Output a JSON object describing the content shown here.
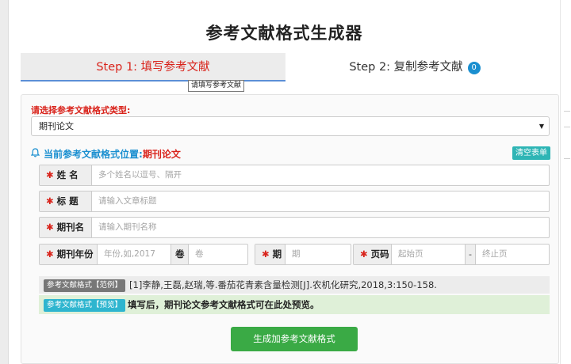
{
  "page_title": "参考文献格式生成器",
  "tabs": [
    {
      "label": "Step 1:  填写参考文献"
    },
    {
      "label": "Step 2:  复制参考文献",
      "badge": "0"
    }
  ],
  "tooltip": "请填写参考文献",
  "type_select": {
    "label": "请选择参考文献格式类型:",
    "value": "期刊论文"
  },
  "position": {
    "prefix": "当前参考文献格式位置:",
    "value": "期刊论文"
  },
  "clear_button": "清空表单",
  "fields": {
    "name": {
      "label": "姓 名",
      "placeholder": "多个姓名以逗号、隔开"
    },
    "title": {
      "label": "标 题",
      "placeholder": "请输入文章标题"
    },
    "journal": {
      "label": "期刊名",
      "placeholder": "请输入期刊名称"
    },
    "year": {
      "label": "期刊年份",
      "placeholder": "年份,如,2017"
    },
    "volume": {
      "label": "卷",
      "placeholder": "卷"
    },
    "issue": {
      "label": "期",
      "placeholder": "期"
    },
    "pages": {
      "label": "页码",
      "start_placeholder": "起始页",
      "dash": "-",
      "end_placeholder": "终止页"
    }
  },
  "example": {
    "tag": "参考文献格式【范例】",
    "text": "[1]李静,王磊,赵瑞,等.番茄花青素含量检测[J].农机化研究,2018,3:150-158."
  },
  "preview": {
    "tag": "参考文献格式【预览】",
    "text": "填写后，期刊论文参考文献格式可在此处预览。"
  },
  "generate_button": "生成加参考文献格式",
  "colors": {
    "accent_red": "#d9241c",
    "accent_blue": "#1a8fd0",
    "teal": "#2eb5b5",
    "green": "#3aaa45"
  },
  "icons": {
    "bell": "bell-icon",
    "select_arrow": "chevron-down-icon",
    "required": "asterisk-icon"
  }
}
